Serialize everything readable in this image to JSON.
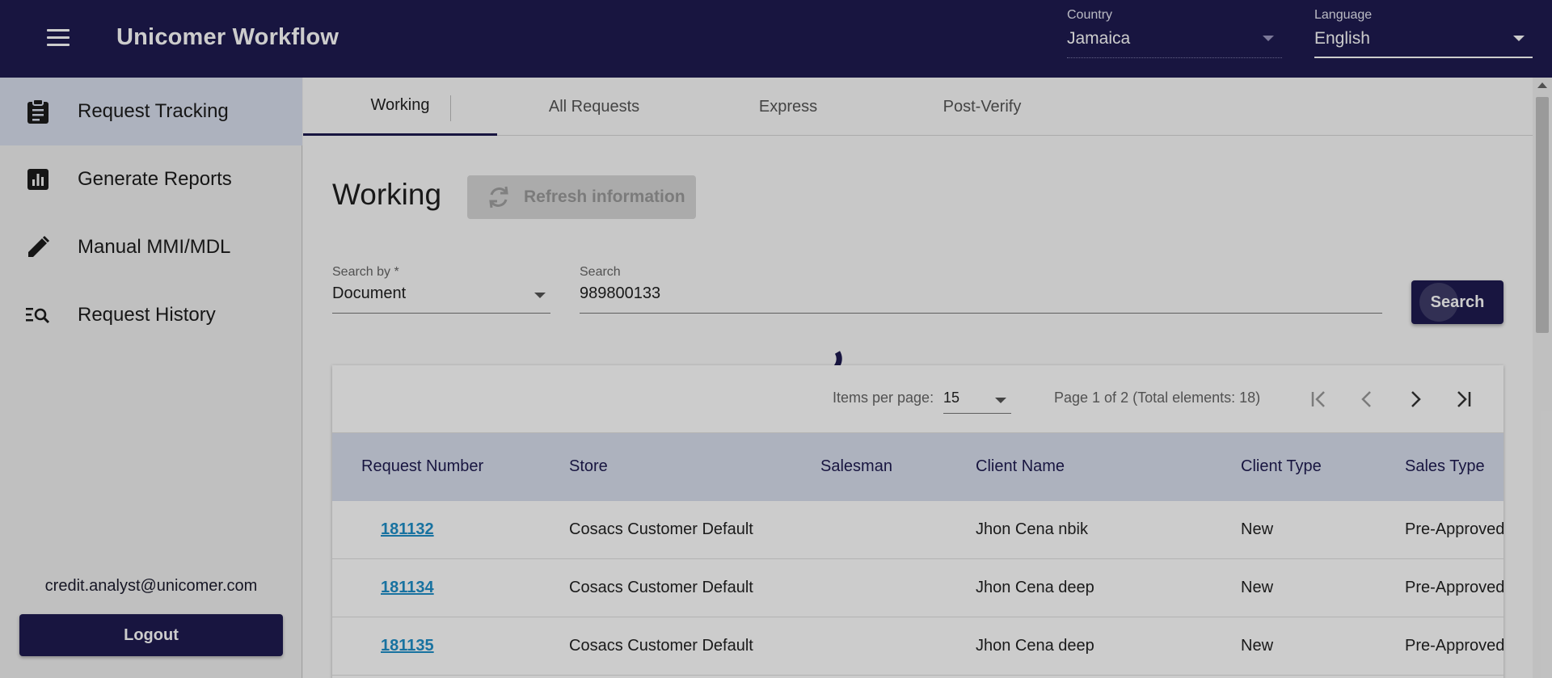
{
  "header": {
    "title": "Unicomer Workflow",
    "country_label": "Country",
    "country_value": "Jamaica",
    "language_label": "Language",
    "language_value": "English"
  },
  "sidebar": {
    "items": [
      {
        "label": "Request Tracking",
        "icon": "clipboard-icon"
      },
      {
        "label": "Generate Reports",
        "icon": "chart-report-icon"
      },
      {
        "label": "Manual MMI/MDL",
        "icon": "pencil-icon"
      },
      {
        "label": "Request History",
        "icon": "list-search-icon"
      }
    ],
    "user_email": "credit.analyst@unicomer.com",
    "logout_label": "Logout"
  },
  "tabs": [
    {
      "label": "Working",
      "active": true
    },
    {
      "label": "All Requests"
    },
    {
      "label": "Express"
    },
    {
      "label": "Post-Verify"
    }
  ],
  "main": {
    "heading": "Working",
    "refresh_label": "Refresh information",
    "search_by_label": "Search by *",
    "search_by_value": "Document",
    "search_label": "Search",
    "search_value": "989800133",
    "search_button": "Search"
  },
  "paginator": {
    "items_per_page_label": "Items per page:",
    "items_per_page_value": "15",
    "range_label": "Page 1 of 2 (Total elements: 18)"
  },
  "table": {
    "columns": [
      "Request Number",
      "Store",
      "Salesman",
      "Client Name",
      "Client Type",
      "Sales Type"
    ],
    "rows": [
      [
        "181132",
        "Cosacs Customer Default",
        "",
        "Jhon Cena nbik",
        "New",
        "Pre-Approved"
      ],
      [
        "181134",
        "Cosacs Customer Default",
        "",
        "Jhon Cena deep",
        "New",
        "Pre-Approved"
      ],
      [
        "181135",
        "Cosacs Customer Default",
        "",
        "Jhon Cena deep",
        "New",
        "Pre-Approved"
      ]
    ]
  },
  "colors": {
    "primary": "#1e1b50",
    "active_row": "#d9dfee",
    "link": "#1f8fc8"
  }
}
